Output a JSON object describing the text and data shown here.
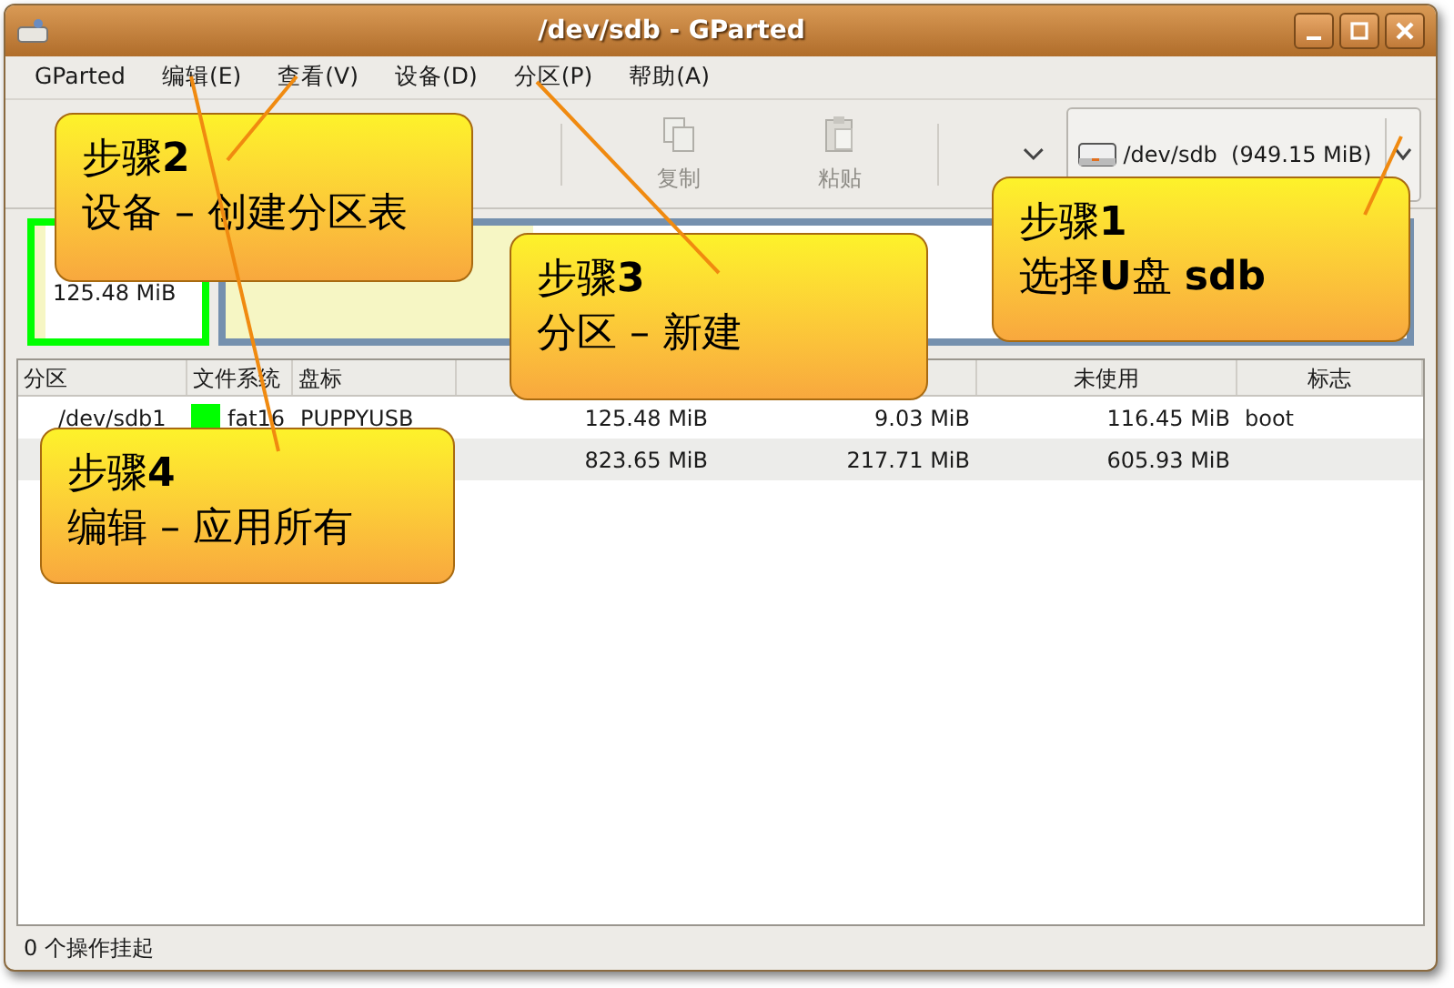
{
  "window": {
    "title": "/dev/sdb - GParted"
  },
  "menu": [
    "GParted",
    "编辑(E)",
    "查看(V)",
    "设备(D)",
    "分区(P)",
    "帮助(A)"
  ],
  "toolbar": [
    {
      "label": "复制",
      "kind": "copy",
      "disabled": true
    },
    {
      "label": "粘贴",
      "kind": "paste",
      "disabled": true
    }
  ],
  "device": {
    "value": "/dev/sdb  (949.15 MiB)"
  },
  "map": [
    {
      "size": "125.48 MiB",
      "color": "#00ff00",
      "level": 0.07
    },
    {
      "color": "#7590ae",
      "level": 0.26
    }
  ],
  "table": {
    "columns": [
      "分区",
      "文件系统",
      "盘标",
      "",
      "",
      "未使用",
      "标志"
    ],
    "rows": [
      {
        "partition": "/dev/sdb1",
        "filesystem": "fat16",
        "color": "#00ff00",
        "label": "PUPPYUSB",
        "size": "125.48 MiB",
        "used": "9.03 MiB",
        "unused": "116.45 MiB",
        "flags": "boot"
      },
      {
        "size": "823.65 MiB",
        "used": "217.71 MiB",
        "unused": "605.93 MiB"
      }
    ]
  },
  "status_bar": "0 个操作挂起",
  "callouts": [
    {
      "title": "步骤**2**",
      "text": "设备 – 创建分区表"
    },
    {
      "title": "步骤**3**",
      "text": "分区 – 新建"
    },
    {
      "title": "步骤**1**",
      "text": "选择**U**盘 **sdb**"
    },
    {
      "title": "步骤**4**",
      "text": "编辑 – 应用所有"
    }
  ]
}
